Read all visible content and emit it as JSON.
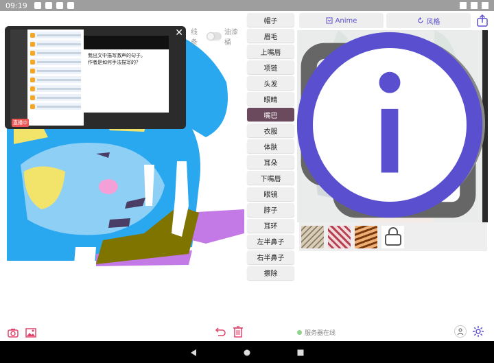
{
  "statusbar": {
    "time": "09:19"
  },
  "canvas": {
    "toggle_label_line": "线条",
    "toggle_label_bucket": "油漆桶"
  },
  "overlay": {
    "badge": "直播中",
    "article_line1": "我出文中描写激声的句子。",
    "article_line2": "作者是如何手法描写的？"
  },
  "parts": [
    {
      "label": "帽子"
    },
    {
      "label": "眉毛"
    },
    {
      "label": "上嘴唇"
    },
    {
      "label": "项链"
    },
    {
      "label": "头发"
    },
    {
      "label": "眼睛"
    },
    {
      "label": "嘴巴"
    },
    {
      "label": "衣服"
    },
    {
      "label": "体肤"
    },
    {
      "label": "耳朵"
    },
    {
      "label": "下嘴唇"
    },
    {
      "label": "眼镜"
    },
    {
      "label": "脖子"
    },
    {
      "label": "耳环"
    },
    {
      "label": "左半鼻子"
    },
    {
      "label": "右半鼻子"
    },
    {
      "label": "擦除"
    }
  ],
  "active_part": "嘴巴",
  "top_buttons": {
    "anime": "Anime",
    "style": "风格"
  },
  "server_status": "服务器在线",
  "colors": {
    "accent": "#5a4fcf",
    "active_part_bg": "#6c4a5e",
    "paint_blue": "#29a8f0",
    "paint_lightblue": "#8ecff5",
    "paint_olive": "#807400",
    "paint_purple": "#c47ae6",
    "status_green": "#8ed28e"
  }
}
